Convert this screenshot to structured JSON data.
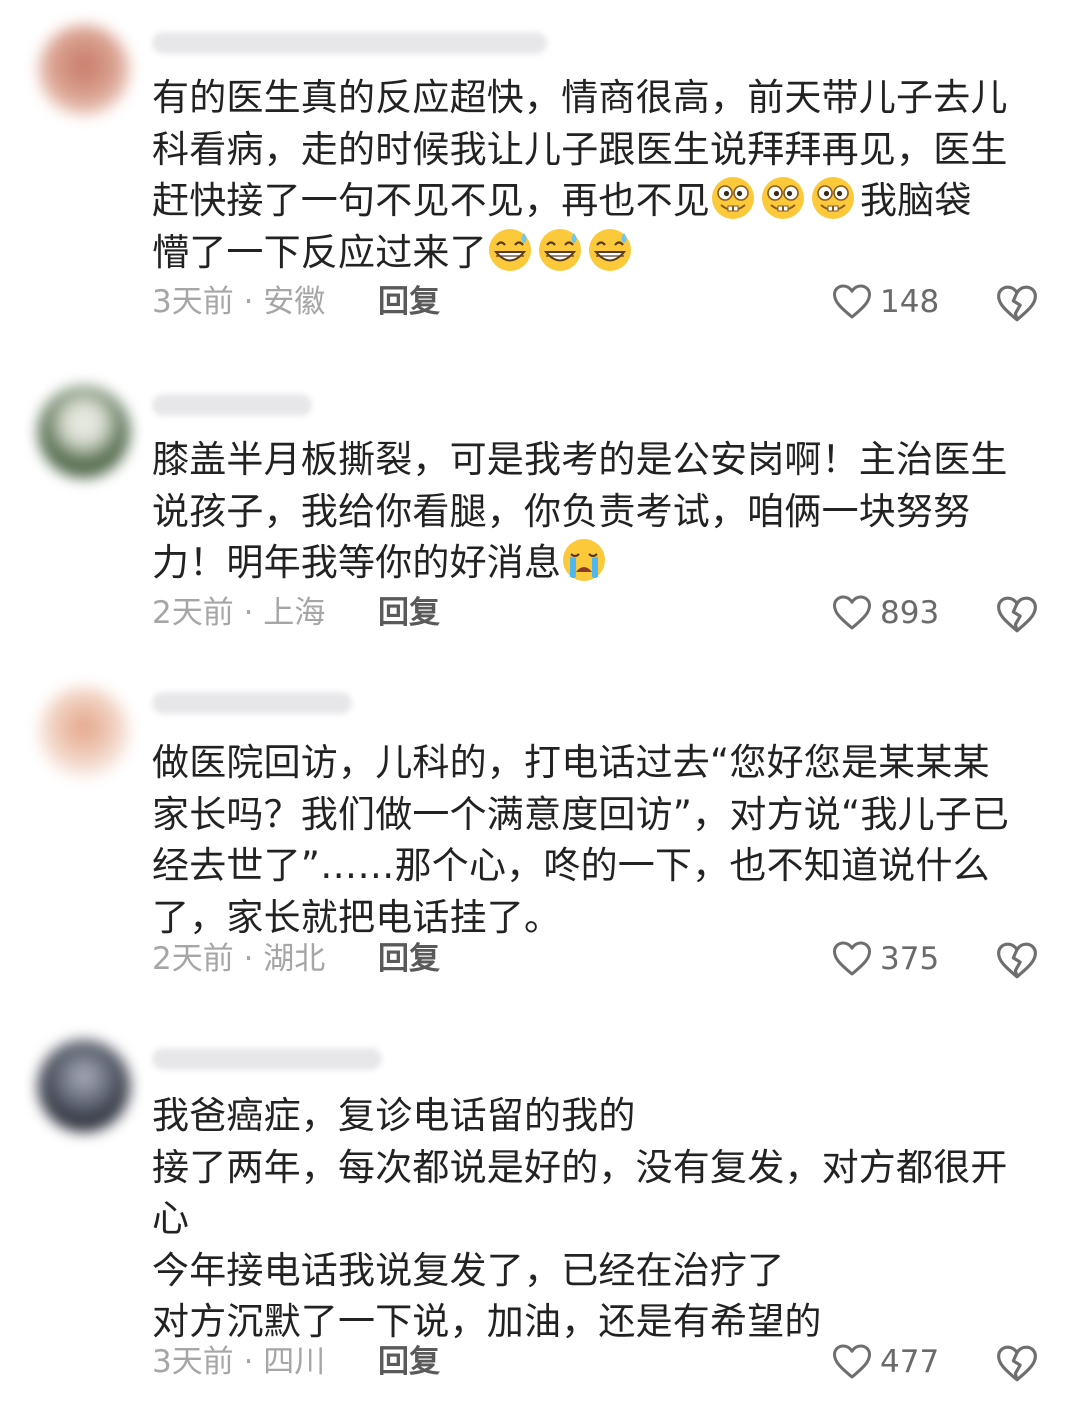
{
  "comments": [
    {
      "lines": [
        "有的医生真的反应超快，情商很高，前天带儿子去儿",
        "科看病，走的时候我让儿子跟医生说拜拜再见，医生",
        "赶快接了一句不见不见，再也不见",
        "我脑袋",
        "懵了一下反应过来了"
      ],
      "emoji_names": [
        "silly-face-emoji",
        "grin-sweat-emoji"
      ],
      "meta": "3天前 · 安徽",
      "reply": "回复",
      "likes": "148"
    },
    {
      "lines": [
        "膝盖半月板撕裂，可是我考的是公安岗啊！主治医生",
        "说孩子，我给你看腿，你负责考试，咱俩一块努努",
        "力！明年我等你的好消息"
      ],
      "emoji_names": [
        "crying-face-emoji"
      ],
      "meta": "2天前 · 上海",
      "reply": "回复",
      "likes": "893"
    },
    {
      "lines": [
        "做医院回访，儿科的，打电话过去“您好您是某某某",
        "家长吗？我们做一个满意度回访”，对方说“我儿子已",
        "经去世了”……那个心，咚的一下，也不知道说什么",
        "了，家长就把电话挂了。"
      ],
      "meta": "2天前 · 湖北",
      "reply": "回复",
      "likes": "375"
    },
    {
      "lines": [
        "我爸癌症，复诊电话留的我的",
        "接了两年，每次都说是好的，没有复发，对方都很开",
        "心",
        "今年接电话我说复发了，已经在治疗了",
        "对方沉默了一下说，加油，还是有希望的"
      ],
      "meta": "3天前 · 四川",
      "reply": "回复",
      "likes": "477"
    }
  ],
  "icons": {
    "like": "heart-outline-icon",
    "dislike": "broken-heart-icon"
  },
  "colors": {
    "text": "#222222",
    "meta": "#a6a6a6",
    "reply": "#5a5a5a",
    "icon": "#6e6e6e",
    "emoji_yellow": "#fbc93a"
  }
}
